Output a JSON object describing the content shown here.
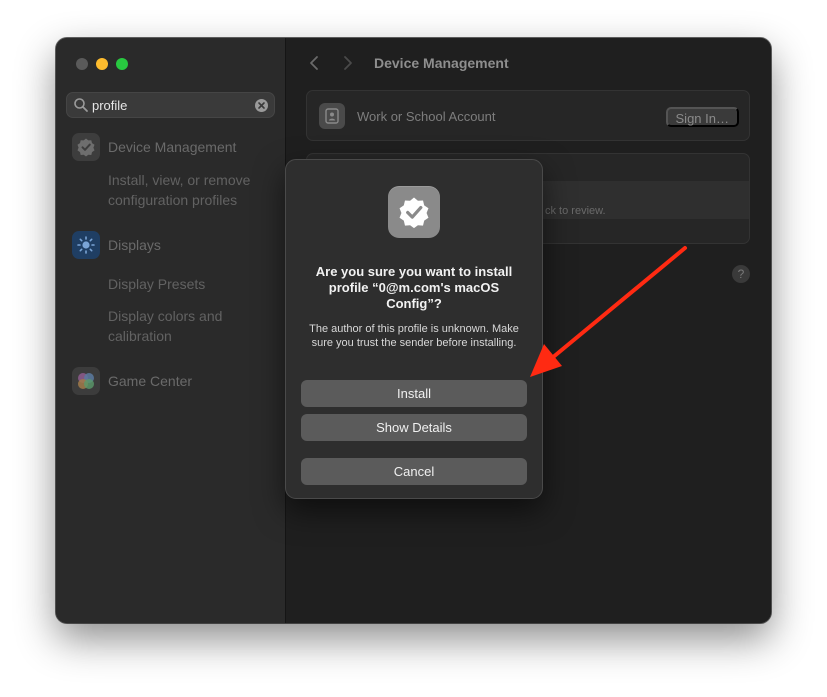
{
  "sidebar": {
    "search": {
      "value": "profile",
      "placeholder": "Search"
    },
    "items": [
      {
        "label": "Device Management",
        "icon": "checkmark-badge-icon"
      },
      {
        "label": "Displays",
        "icon": "sun-icon"
      },
      {
        "label": "Game Center",
        "icon": "game-center-icon"
      }
    ],
    "sub_device": "Install, view, or remove configuration profiles",
    "sub_display_presets": "Display Presets",
    "sub_display_colors": "Display colors and calibration"
  },
  "main": {
    "title": "Device Management",
    "account_label": "Work or School Account",
    "sign_in": "Sign In…",
    "review_fragment": "ck to review.",
    "help": "?"
  },
  "dialog": {
    "title": "Are you sure you want to install profile “0@m.com's macOS Config”?",
    "message": "The author of this profile is unknown. Make sure you trust the sender before installing.",
    "install": "Install",
    "show_details": "Show Details",
    "cancel": "Cancel"
  },
  "colors": {
    "accent_arrow": "#ff2a12",
    "window_bg": "#1e1e1e",
    "traffic_min": "#febc2e",
    "traffic_max": "#28c840"
  }
}
